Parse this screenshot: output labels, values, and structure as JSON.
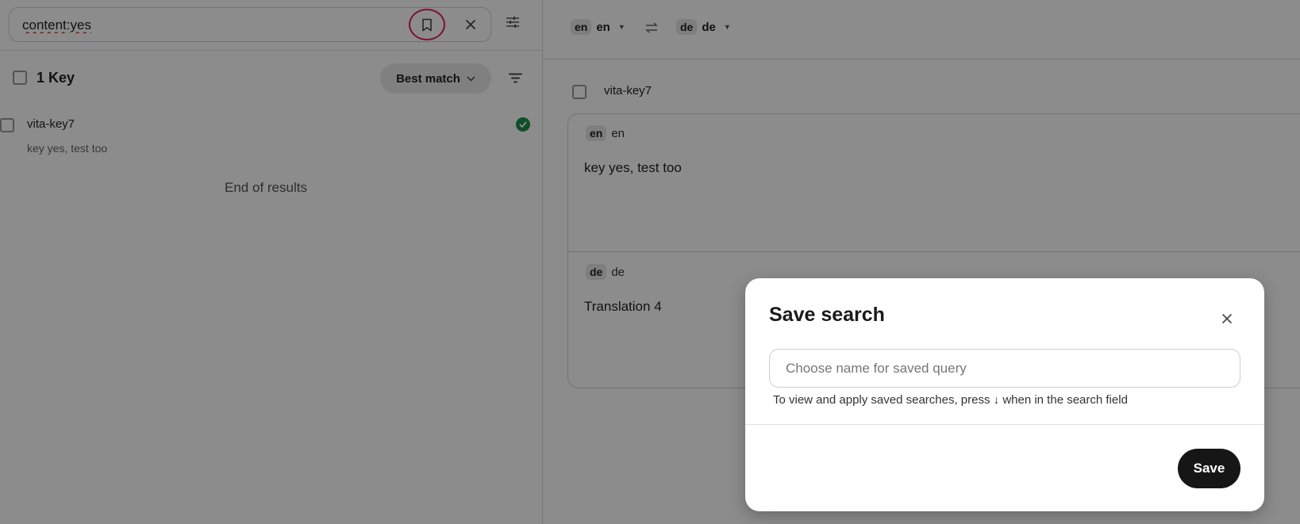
{
  "search": {
    "value": "content:yes"
  },
  "results": {
    "count_label": "1 Key",
    "sort_label": "Best match",
    "items": [
      {
        "key": "vita-key7",
        "translation": "key yes, test too"
      }
    ],
    "end_label": "End of results"
  },
  "languages": {
    "source": {
      "code": "en",
      "label": "en"
    },
    "target": {
      "code": "de",
      "label": "de"
    }
  },
  "detail": {
    "key": "vita-key7",
    "cells": [
      {
        "code": "en",
        "label": "en",
        "text": "key yes, test too"
      },
      {
        "code": "de",
        "label": "de",
        "text": "Translation 4"
      }
    ]
  },
  "dialog": {
    "title": "Save search",
    "input_placeholder": "Choose name for saved query",
    "hint": "To view and apply saved searches, press ↓ when in the search field",
    "save_label": "Save"
  },
  "colors": {
    "accent_ring": "#e0245e",
    "status_ok": "#1e8e4e",
    "primary_button": "#161616"
  },
  "icons": [
    "bookmark-icon",
    "close-icon",
    "adjust-icon",
    "chevron-down-icon",
    "filter-icon",
    "check-icon",
    "swap-icon",
    "caret-down-icon"
  ]
}
